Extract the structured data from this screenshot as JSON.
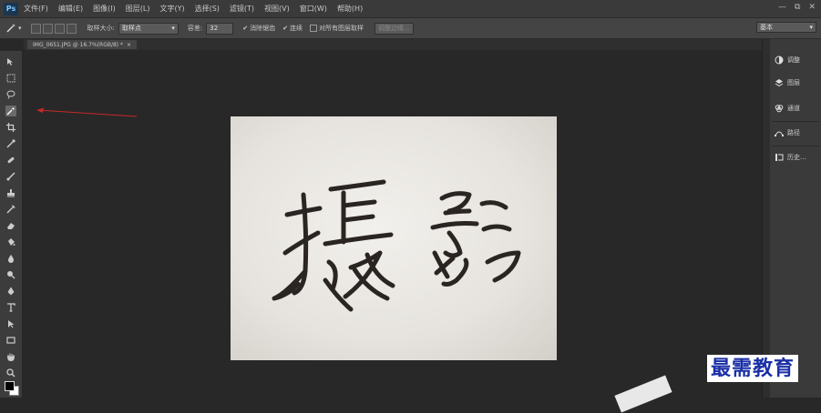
{
  "app": {
    "logo_text": "Ps"
  },
  "menu": [
    "文件(F)",
    "编辑(E)",
    "图像(I)",
    "图层(L)",
    "文字(Y)",
    "选择(S)",
    "滤镜(T)",
    "视图(V)",
    "窗口(W)",
    "帮助(H)"
  ],
  "window_controls": [
    "—",
    "⧉",
    "✕"
  ],
  "options": {
    "sample_size_label": "取样大小:",
    "sample_size_value": "取样点",
    "tolerance_label": "容差:",
    "tolerance_value": "32",
    "antialias_label": "消除锯齿",
    "contiguous_label": "连续",
    "all_layers_label": "对所有图层取样",
    "refine_edge_label": "调整边缘...",
    "workspace_value": "基本"
  },
  "document": {
    "tab_title": "IMG_0651.JPG @ 16.7%(RGB/8) *",
    "close": "×"
  },
  "tools": [
    "move-icon",
    "marquee-icon",
    "lasso-icon",
    "magic-wand-icon",
    "crop-icon",
    "eyedropper-icon",
    "healing-brush-icon",
    "brush-icon",
    "clone-stamp-icon",
    "history-brush-icon",
    "eraser-icon",
    "paint-bucket-icon",
    "blur-icon",
    "dodge-icon",
    "pen-icon",
    "type-icon",
    "path-select-icon",
    "rectangle-icon",
    "hand-icon",
    "zoom-icon"
  ],
  "panels": [
    {
      "label": "调整",
      "icon": "adjustments-icon"
    },
    {
      "label": "图层",
      "icon": "layers-icon"
    },
    {
      "label": "通道",
      "icon": "channels-icon"
    },
    {
      "label": "路径",
      "icon": "paths-icon"
    },
    {
      "label": "历史...",
      "icon": "history-icon"
    }
  ],
  "watermark": "最需教育",
  "colors": {
    "annotation": "#c82828",
    "watermark": "#1a2fa6"
  }
}
